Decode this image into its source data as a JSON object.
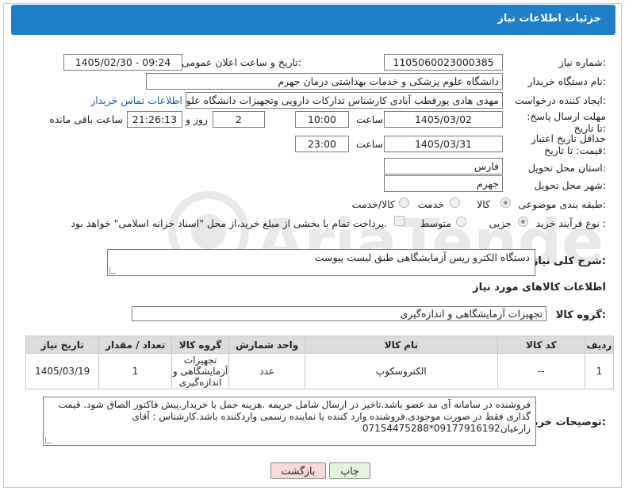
{
  "header": {
    "title": "جزئیات اطلاعات نیاز"
  },
  "fields": {
    "need_number_label": "شماره نیاز:",
    "need_number": "1105060023000385",
    "announce_label": "تاریخ و ساعت اعلان عمومی:",
    "announce_value": "1405/02/30 - 09:24",
    "buyer_org_label": "نام دستگاه خریدار:",
    "buyer_org": "دانشگاه علوم پزشکی و خدمات بهداشتی  درمان جهرم",
    "creator_label": "ایجاد کننده درخواست:",
    "creator": "مهدی هادی پورقطب آبادی کارشناس تدارکات دارویی وتجهیزات دانشگاه علوم پز",
    "contact_link": "اطلاعات تماس خریدار",
    "deadline_label": "مهلت ارسال پاسخ: تا تاریخ:",
    "deadline_date": "1405/03/02",
    "time_label": "ساعت",
    "deadline_time": "10:00",
    "days_value": "2",
    "days_label": "روز و",
    "remaining_time": "21:26:13",
    "remaining_label": "ساعت باقی مانده",
    "price_validity_label": "حداقل تاریخ اعتبار قیمت: تا تاریخ:",
    "price_validity_date": "1405/03/31",
    "price_validity_time": "23:00",
    "province_label": "استان محل تحویل:",
    "province": "فارس",
    "city_label": "شهر محل تحویل:",
    "city": "جهرم",
    "category_label": "طبقه بندی موضوعی:",
    "category_options": [
      "کالا",
      "خدمت",
      "کالا/خدمت"
    ],
    "process_label": "نوع فرآیند خرید :",
    "process_options": [
      "جزیی",
      "متوسط"
    ],
    "payment_note": "پرداخت تمام یا بخشی از مبلغ خرید،از محل \"اسناد خزانه اسلامی\" خواهد بود."
  },
  "summary": {
    "label": "شرح کلی نیاز:",
    "text": "دستگاه الکترو ریس آزمایشگاهی طبق لیست پیوست"
  },
  "goods": {
    "section_title": "اطلاعات کالاهای مورد نیاز",
    "group_label": "گروه کالا:",
    "group_value": "تجهیزات آزمایشگاهی و اندازه‌گیری"
  },
  "table": {
    "headers": [
      "ردیف",
      "کد کالا",
      "نام کالا",
      "واحد شمارش",
      "گروه کالا",
      "تعداد / مقدار",
      "تاریخ نیاز"
    ],
    "rows": [
      [
        "1",
        "--",
        "الکتروسکوپ",
        "عدد",
        "تجهیزات آزمایشگاهی و اندازه‌گیری",
        "1",
        "1405/03/19"
      ]
    ]
  },
  "buyer_notes": {
    "label": "توضیحات خریدار:",
    "text": "فروشنده در سامانه آی مد عضو باشد.تاخیر در ارسال شامل جریمه .هزینه حمل با خریدار.پیش فاکتور الصاق شود. قیمت گذاری فقط در صورت موجودی.فروشنده وارد کننده یا نماینده رسمی واردکننده باشد.کارشناس : آقای زارعیان09177916192*07154475288"
  },
  "buttons": {
    "print": "چاپ",
    "back": "بازگشت"
  },
  "colors": {
    "header": "#1e7ec7",
    "print_btn": "#e3f4dc",
    "back_btn": "#f8dada",
    "link": "#1a5fb4"
  }
}
